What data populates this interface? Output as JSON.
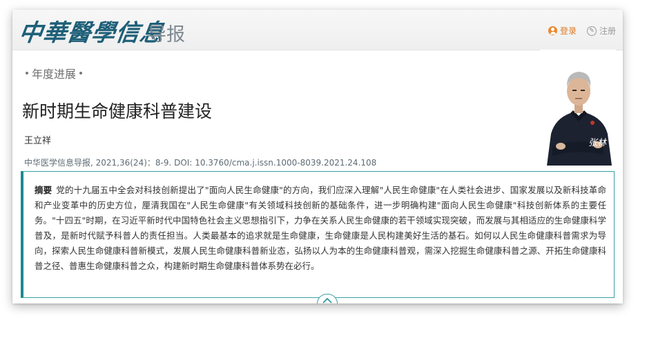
{
  "header": {
    "logo_calligraphy": "中華醫學信息",
    "logo_text": "导报",
    "login_label": "登录",
    "register_label": "注册"
  },
  "article": {
    "section": "年度进展",
    "title": "新时期生命健康科普建设",
    "author": "王立祥",
    "citation": "中华医学信息导报, 2021,36(24)：8-9. DOI: 10.3760/cma.j.issn.1000-8039.2021.24.108",
    "abstract_label": "摘要",
    "abstract_text": "党的十九届五中全会对科技创新提出了\"面向人民生命健康\"的方向，我们应深入理解\"人民生命健康\"在人类社会进步、国家发展以及新科技革命和产业变革中的历史方位，厘清我国在\"人民生命健康\"有关领域科技创新的基础条件，进一步明确构建\"面向人民生命健康\"科技创新体系的主要任务。\"十四五\"时期，在习近平新时代中国特色社会主义思想指引下，力争在关系人民生命健康的若干领域实现突破，而发展与其相适应的生命健康科学普及，是新时代赋予科普人的责任担当。人类最基本的追求就是生命健康，生命健康是人民构建美好生活的基石。如何以人民生命健康科普需求为导向，探索人民生命健康科普新模式，发展人民生命健康科普新业态，弘扬以人为本的生命健康科普观，需深入挖掘生命健康科普之源、开拓生命健康科普之径、普惠生命健康科普之众，构建新时期生命健康科普体系势在必行。",
    "signature": "张林"
  },
  "colors": {
    "accent": "#1a8a90",
    "login": "#e07a22",
    "logo": "#1e5f78"
  }
}
